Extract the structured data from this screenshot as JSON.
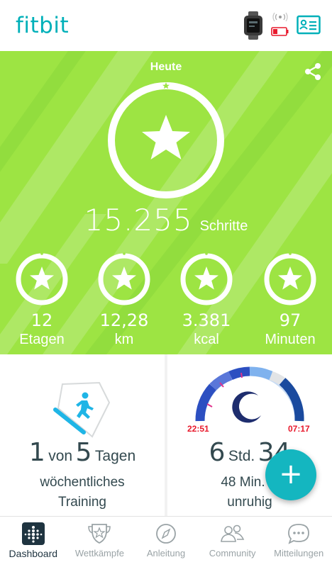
{
  "header": {
    "logo": "fitbit",
    "device_icon": "smartwatch-icon",
    "battery_icon": "battery-low-icon",
    "profile_icon": "profile-card-icon",
    "colors": {
      "brand": "#00b0b9",
      "battery_low": "#e8192c"
    }
  },
  "hero": {
    "title": "Heute",
    "steps_value": "15.255",
    "steps_unit": "Schritte",
    "background": "#9de443",
    "stats": [
      {
        "value": "12",
        "label": "Etagen"
      },
      {
        "value": "12,28",
        "label": "km"
      },
      {
        "value": "3.381",
        "label": "kcal"
      },
      {
        "value": "97",
        "label": "Minuten"
      }
    ]
  },
  "exercise_card": {
    "count": "1",
    "von": "von",
    "goal": "5",
    "tagen": "Tagen",
    "line2": "wöchentliches",
    "line3": "Training",
    "accent": "#1fb5e6"
  },
  "sleep_card": {
    "start_time": "22:51",
    "end_time": "07:17",
    "hours": "6",
    "hours_unit": "Std.",
    "minutes": "34",
    "restless_text": "48 Min. w",
    "line3": "unruhig",
    "colors": {
      "start": "#e8192c",
      "end": "#e8192c",
      "moon": "#1e2d6e"
    }
  },
  "fab": {
    "label": "+"
  },
  "nav": [
    {
      "label": "Dashboard",
      "active": true
    },
    {
      "label": "Wettkämpfe"
    },
    {
      "label": "Anleitung"
    },
    {
      "label": "Community"
    },
    {
      "label": "Mitteilungen"
    }
  ]
}
